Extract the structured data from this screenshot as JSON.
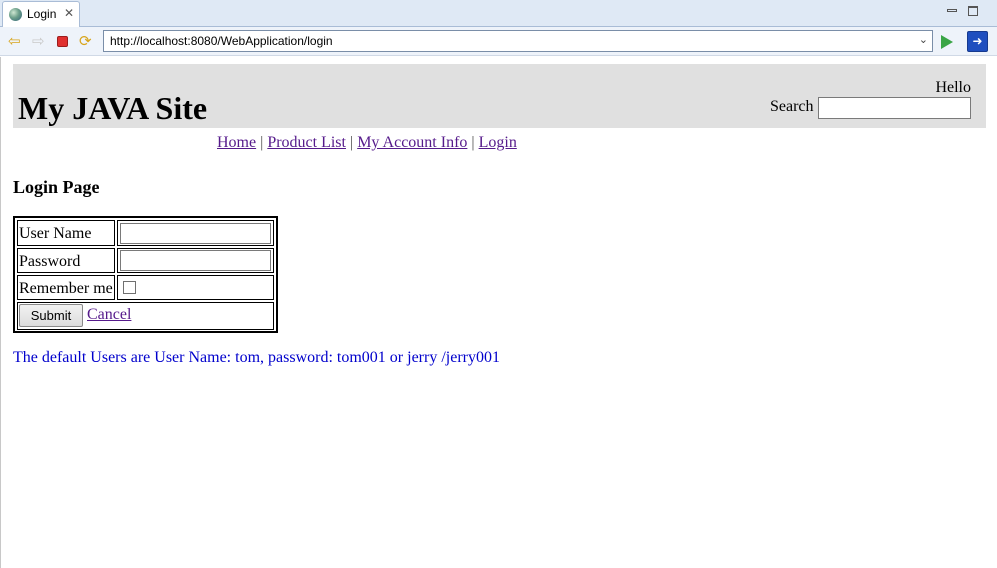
{
  "browser": {
    "tab_title": "Login",
    "url": "http://localhost:8080/WebApplication/login"
  },
  "header": {
    "site_title": "My JAVA Site",
    "greeting": "Hello",
    "search_label": "Search",
    "search_value": ""
  },
  "nav": {
    "items": [
      "Home",
      "Product List",
      "My Account Info",
      "Login"
    ],
    "separator": "|"
  },
  "page": {
    "heading": "Login Page"
  },
  "form": {
    "username_label": "User Name",
    "username_value": "",
    "password_label": "Password",
    "password_value": "",
    "remember_label": "Remember me",
    "remember_checked": false,
    "submit_label": "Submit",
    "cancel_label": "Cancel"
  },
  "note": "The default Users are User Name: tom, password: tom001 or jerry /jerry001"
}
